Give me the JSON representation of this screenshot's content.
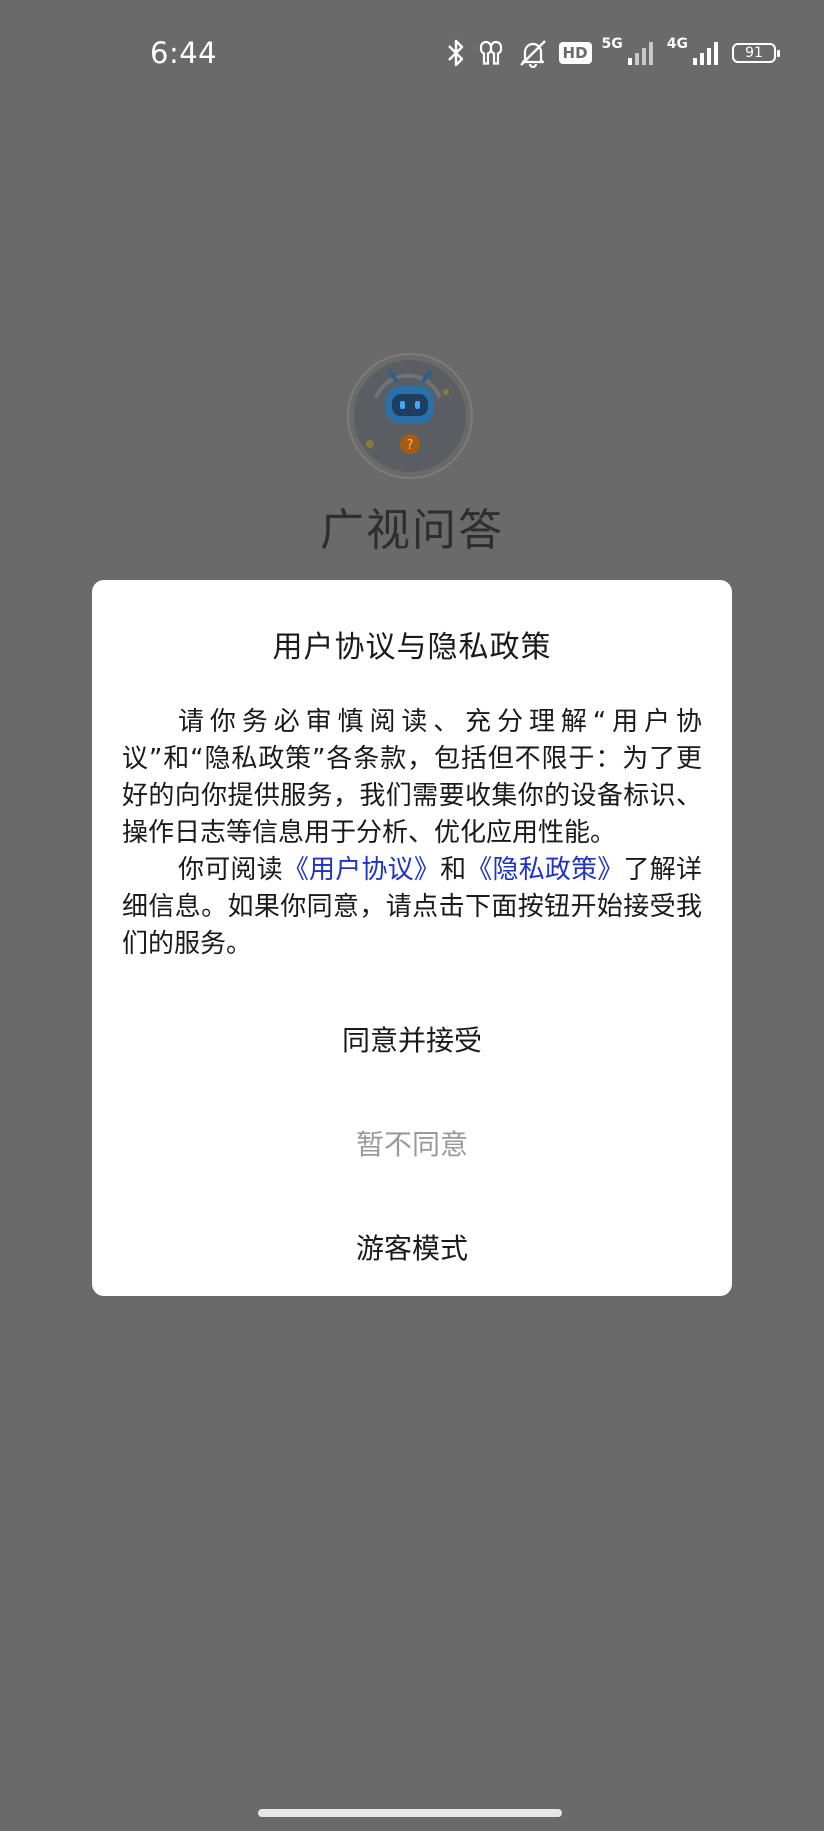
{
  "status_bar": {
    "time": "6:44",
    "hd_label": "HD",
    "network_5g": "5G",
    "network_4g": "4G",
    "battery_level": "91",
    "icons": [
      "bluetooth-icon",
      "earbuds-icon",
      "mute-icon",
      "hd-icon",
      "signal-5g-icon",
      "signal-4g-icon",
      "battery-icon"
    ]
  },
  "app": {
    "name": "广视问答",
    "logo_icon": "robot-mascot-icon"
  },
  "dialog": {
    "title": "用户协议与隐私政策",
    "paragraph1": "请你务必审慎阅读、充分理解“用户协议”和“隐私政策”各条款，包括但不限于：为了更好的向你提供服务，我们需要收集你的设备标识、操作日志等信息用于分析、优化应用性能。",
    "paragraph2_prefix": "你可阅读",
    "user_agreement_link": "《用户协议》",
    "paragraph2_and": "和",
    "privacy_policy_link": "《隐私政策》",
    "paragraph2_suffix": "了解详细信息。如果你同意，请点击下面按钮开始接受我们的服务。",
    "link_color": "#1e32c8",
    "buttons": {
      "agree": "同意并接受",
      "disagree": "暂不同意",
      "guest": "游客模式"
    }
  }
}
